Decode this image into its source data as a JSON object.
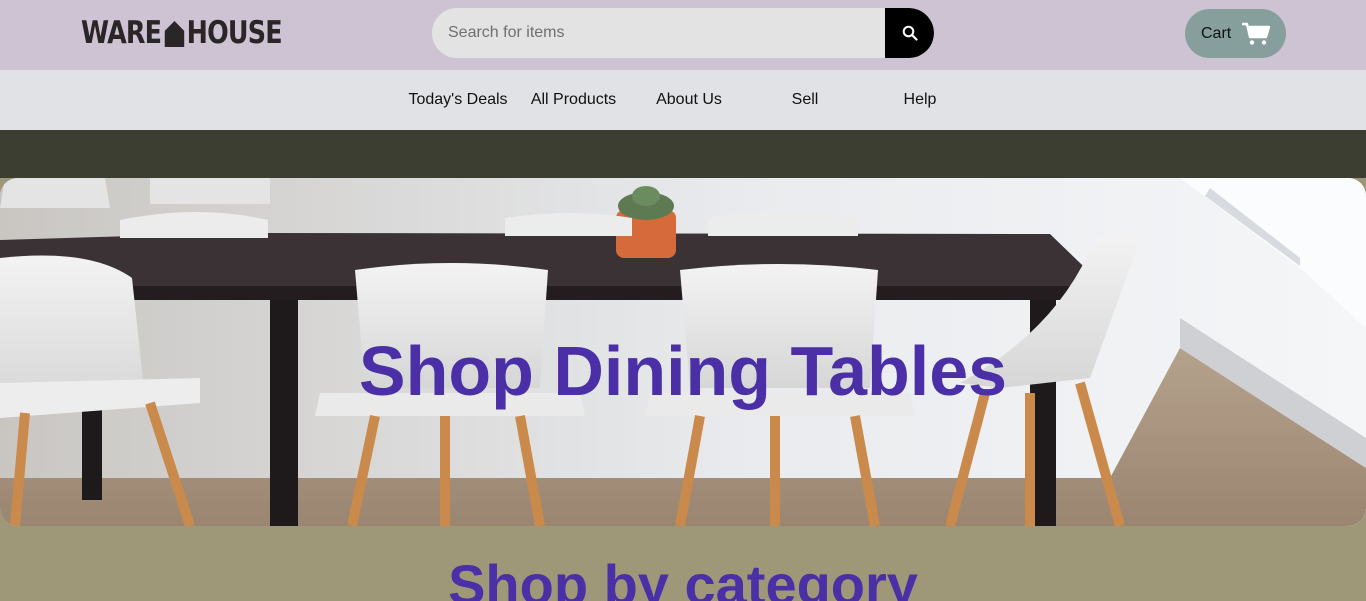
{
  "brand": {
    "logo_left": "WARE",
    "logo_right": "HOUSE"
  },
  "search": {
    "placeholder": "Search for items",
    "icon": "search-icon"
  },
  "cart": {
    "label": "Cart",
    "icon": "shopping-cart-icon"
  },
  "nav": {
    "items": [
      {
        "label": "Today's Deals"
      },
      {
        "label": "All Products"
      },
      {
        "label": "About Us"
      },
      {
        "label": "Sell"
      },
      {
        "label": "Help"
      }
    ]
  },
  "hero": {
    "title": "Shop Dining Tables"
  },
  "category": {
    "title": "Shop by category"
  },
  "colors": {
    "header_bg": "#cdc3d2",
    "nav_bg": "#e1e2e6",
    "cart_bg": "#869f9c",
    "accent_text": "#4a2fa6",
    "section_bg": "#9e9878",
    "band_bg": "#3c3e32"
  }
}
